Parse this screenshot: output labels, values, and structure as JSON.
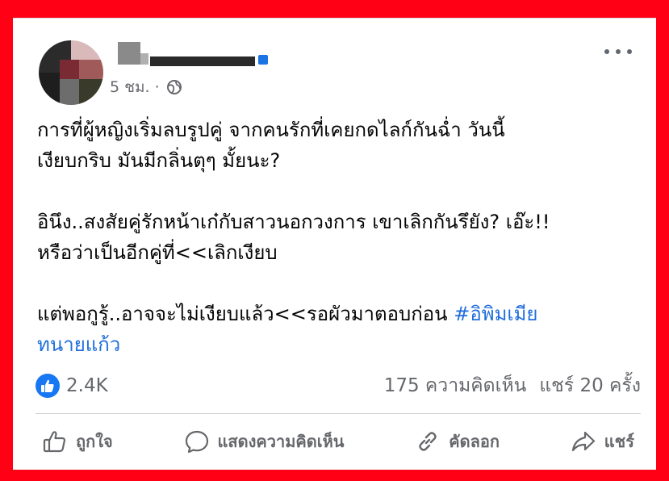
{
  "post": {
    "timestamp": "5 ชม. ·",
    "lines": [
      "การที่ผู้หญิงเริ่มลบรูปคู่ จากคนรักที่เคยกดไลก์กันฉ่ำ วันนี้",
      "เงียบกริบ มันมีกลิ่นตุๆ มั้ยนะ?",
      "",
      "อินึง..สงสัยคู่รักหน้าเก๋กับสาวนอกวงการ เขาเลิกกันรึยัง? เอ๊ะ!!",
      "หรือว่าเป็นอีกคู่ที่<<เลิกเงียบ",
      "",
      "แต่พอกูรู้..อาจจะไม่เงียบแล้ว<<รอผัวมาตอบก่อน "
    ],
    "hashtag_part1": "#อิพิมเมีย",
    "hashtag_part2": "ทนายแก้ว"
  },
  "stats": {
    "likes": "2.4K",
    "comments": "175 ความคิดเห็น",
    "shares": "แชร์ 20 ครั้ง"
  },
  "actions": {
    "like": "ถูกใจ",
    "comment": "แสดงความคิดเห็น",
    "copy": "คัดลอก",
    "share": "แชร์"
  },
  "colors": {
    "frame": "#ff0015",
    "link": "#216fdb",
    "like_blue": "#1877f2",
    "secondary_text": "#65676b"
  },
  "icons": [
    "more-icon",
    "globe-icon",
    "like-thumb-icon",
    "comment-bubble-icon",
    "copy-link-icon",
    "share-arrow-icon"
  ]
}
